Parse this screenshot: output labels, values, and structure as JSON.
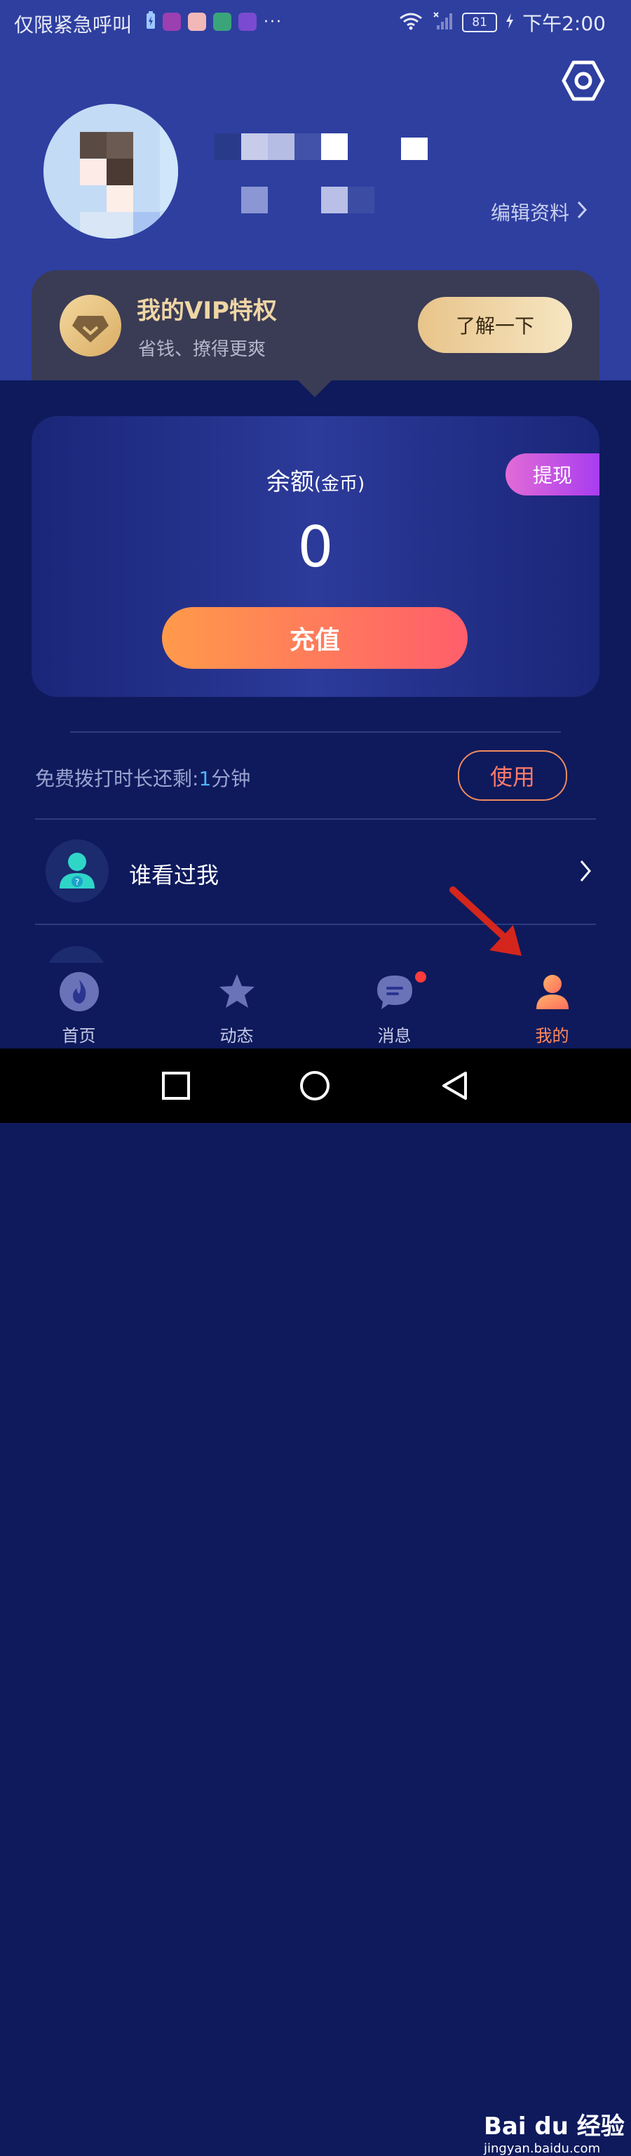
{
  "status_bar": {
    "carrier_text": "仅限紧急呼叫",
    "more": "···",
    "battery": "81",
    "time": "下午2:00"
  },
  "profile": {
    "edit_label": "编辑资料"
  },
  "vip": {
    "title": "我的VIP特权",
    "subtitle": "省钱、撩得更爽",
    "button": "了解一下"
  },
  "wallet": {
    "balance_label": "余额",
    "balance_unit": "(金币)",
    "balance_value": "0",
    "withdraw_label": "提现",
    "recharge_label": "充值"
  },
  "free_call": {
    "prefix": "免费拨打时长还剩:",
    "minutes": "1",
    "suffix": "分钟",
    "use_label": "使用"
  },
  "menu": {
    "who_viewed_me": "谁看过我"
  },
  "tabs": [
    {
      "label": "首页",
      "icon": "fire-icon"
    },
    {
      "label": "动态",
      "icon": "star-icon"
    },
    {
      "label": "消息",
      "icon": "chat-bubble-icon"
    },
    {
      "label": "我的",
      "icon": "person-icon"
    }
  ],
  "active_tab": "我的",
  "watermark": {
    "logo": "Bai du 经验",
    "url": "jingyan.baidu.com"
  },
  "colors": {
    "header_bg": "#2e3fa0",
    "page_bg": "#0e1a5c",
    "accent_orange": "#ff8a5c",
    "vip_gold": "#efd6a5",
    "withdraw_purple": "#c24fe4"
  }
}
